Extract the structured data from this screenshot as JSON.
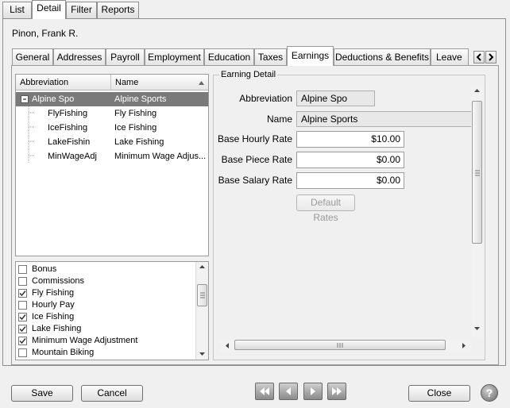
{
  "main_tabs": [
    "List",
    "Detail",
    "Filter",
    "Reports"
  ],
  "employee_name": "Pinon, Frank R.",
  "sub_tabs": [
    "General",
    "Addresses",
    "Payroll",
    "Employment",
    "Education",
    "Taxes",
    "Earnings",
    "Deductions & Benefits",
    "Leave"
  ],
  "active_sub_tab": "Earnings",
  "earnings_grid": {
    "columns": [
      "Abbreviation",
      "Name"
    ],
    "rows": [
      {
        "abbr": "Alpine Spo",
        "name": "Alpine Sports",
        "selected": true
      },
      {
        "abbr": "FlyFishing",
        "name": "Fly Fishing"
      },
      {
        "abbr": "IceFishing",
        "name": "Ice Fishing"
      },
      {
        "abbr": "LakeFishin",
        "name": "Lake Fishing"
      },
      {
        "abbr": "MinWageAdj",
        "name": "Minimum Wage Adjus..."
      }
    ]
  },
  "earnings_checklist": [
    {
      "label": "Bonus",
      "checked": false
    },
    {
      "label": "Commissions",
      "checked": false
    },
    {
      "label": "Fly Fishing",
      "checked": true
    },
    {
      "label": "Hourly Pay",
      "checked": false
    },
    {
      "label": "Ice Fishing",
      "checked": true
    },
    {
      "label": "Lake Fishing",
      "checked": true
    },
    {
      "label": "Minimum Wage Adjustment",
      "checked": true
    },
    {
      "label": "Mountain Biking",
      "checked": false
    }
  ],
  "detail": {
    "group_title": "Earning Detail",
    "abbreviation_label": "Abbreviation",
    "abbreviation_value": "Alpine Spo",
    "name_label": "Name",
    "name_value": "Alpine Sports",
    "hourly_label": "Base Hourly Rate",
    "hourly_value": "$10.00",
    "piece_label": "Base Piece Rate",
    "piece_value": "$0.00",
    "salary_label": "Base Salary Rate",
    "salary_value": "$0.00",
    "default_rates_label": "Default Rates"
  },
  "footer": {
    "save_label": "Save",
    "cancel_label": "Cancel",
    "close_label": "Close",
    "help_glyph": "?"
  },
  "icons": {
    "collapse": "minus-box",
    "nav": [
      "first-record",
      "previous-record",
      "next-record",
      "last-record"
    ]
  }
}
